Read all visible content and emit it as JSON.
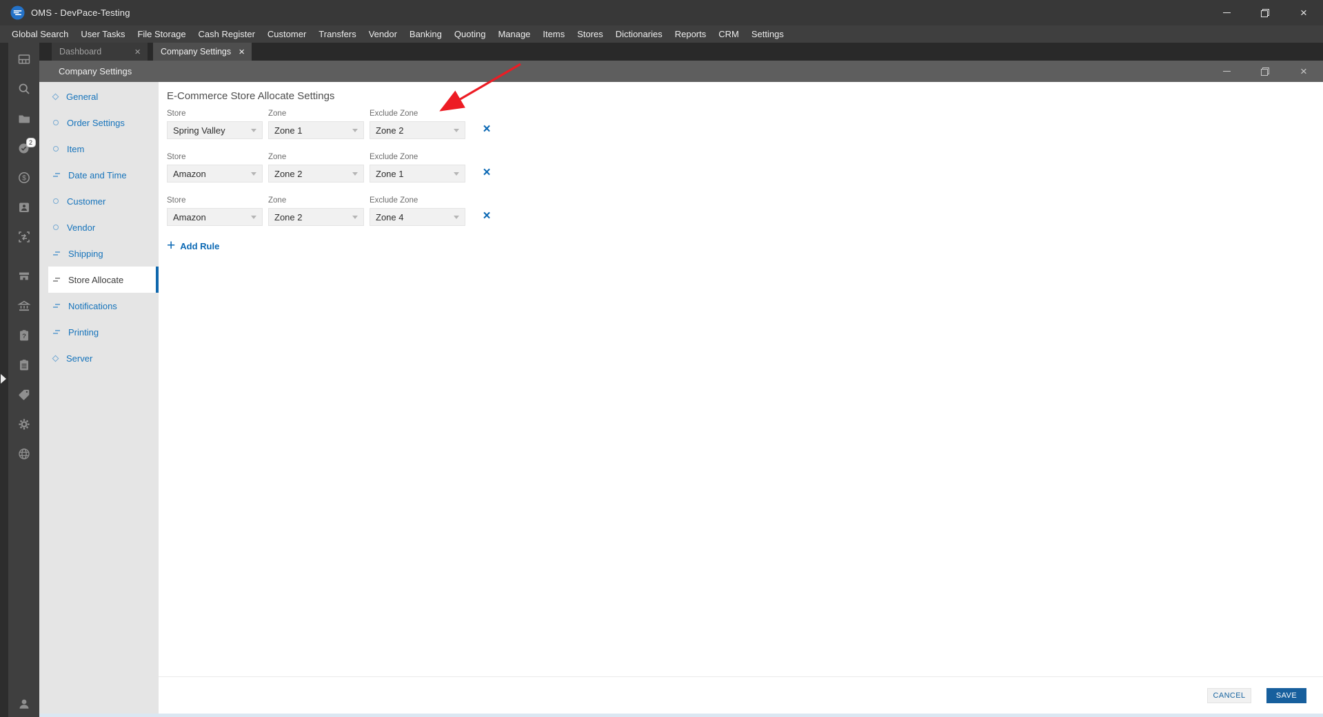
{
  "titlebar": {
    "title": "OMS - DevPace-Testing"
  },
  "menu": {
    "items": [
      "Global Search",
      "User Tasks",
      "File Storage",
      "Cash Register",
      "Customer",
      "Transfers",
      "Vendor",
      "Banking",
      "Quoting",
      "Manage",
      "Items",
      "Stores",
      "Dictionaries",
      "Reports",
      "CRM",
      "Settings"
    ]
  },
  "tabs": {
    "dashboard": "Dashboard",
    "company_settings": "Company Settings"
  },
  "sidebar": {
    "badge_count": "2",
    "icons": [
      "dashboard-icon",
      "search-icon",
      "folder-icon",
      "tasks-check-icon",
      "money-icon",
      "contact-icon",
      "scan-transfer-icon",
      "store-icon",
      "bank-icon",
      "clipboard-question-icon",
      "clipboard-list-icon",
      "tag-icon",
      "gear-icon",
      "globe-icon",
      "user-icon"
    ]
  },
  "settings_window": {
    "title": "Company Settings",
    "nav": {
      "items": [
        {
          "label": "General",
          "icon": "diamond"
        },
        {
          "label": "Order Settings",
          "icon": "circle"
        },
        {
          "label": "Item",
          "icon": "circle"
        },
        {
          "label": "Date and Time",
          "icon": "lines"
        },
        {
          "label": "Customer",
          "icon": "circle"
        },
        {
          "label": "Vendor",
          "icon": "circle"
        },
        {
          "label": "Shipping",
          "icon": "lines"
        },
        {
          "label": "Store Allocate",
          "icon": "lines",
          "selected": true
        },
        {
          "label": "Notifications",
          "icon": "lines"
        },
        {
          "label": "Printing",
          "icon": "lines"
        },
        {
          "label": "Server",
          "icon": "diamond"
        }
      ]
    },
    "content": {
      "heading": "E-Commerce Store Allocate Settings",
      "field_labels": {
        "store": "Store",
        "zone": "Zone",
        "exclude_zone": "Exclude Zone"
      },
      "rules": [
        {
          "store": "Spring Valley",
          "zone": "Zone 1",
          "exclude_zone": "Zone 2"
        },
        {
          "store": "Amazon",
          "zone": "Zone 2",
          "exclude_zone": "Zone 1"
        },
        {
          "store": "Amazon",
          "zone": "Zone 2",
          "exclude_zone": "Zone 4"
        }
      ],
      "add_rule_label": "Add Rule"
    },
    "footer": {
      "cancel_label": "CANCEL",
      "save_label": "SAVE"
    }
  },
  "colors": {
    "nav_link_blue": "#1573bb",
    "action_blue": "#0a68b4",
    "save_button_blue": "#175f9d",
    "annotation_red": "#ed1c24",
    "titlebar_gray": "#383838",
    "nav_panel_gray": "#e5e5e5"
  }
}
